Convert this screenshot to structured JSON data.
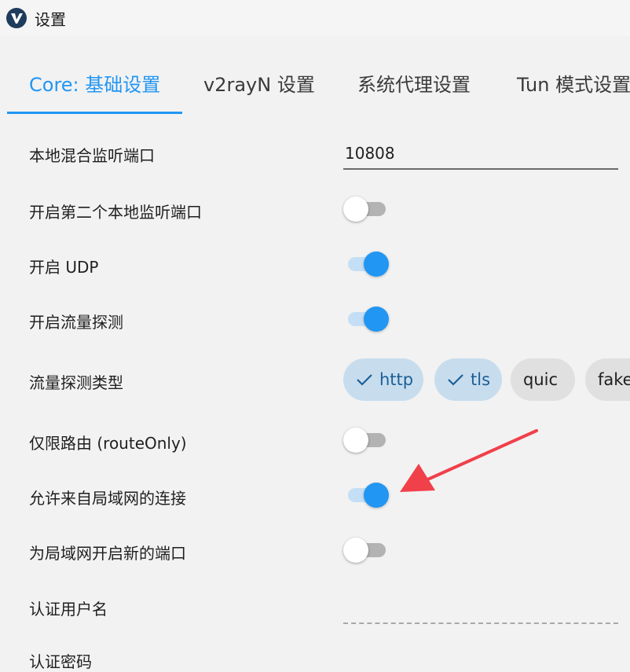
{
  "window": {
    "title": "设置",
    "icon": "v2rayn-app-icon"
  },
  "tabs": [
    {
      "label": "Core: 基础设置",
      "active": true
    },
    {
      "label": "v2rayN 设置",
      "active": false
    },
    {
      "label": "系统代理设置",
      "active": false
    },
    {
      "label": "Tun 模式设置",
      "active": false
    }
  ],
  "settings": {
    "local_port": {
      "label": "本地混合监听端口",
      "value": "10808"
    },
    "second_port": {
      "label": "开启第二个本地监听端口",
      "on": false
    },
    "udp": {
      "label": "开启 UDP",
      "on": true
    },
    "sniffing": {
      "label": "开启流量探测",
      "on": true
    },
    "sniff_types": {
      "label": "流量探测类型",
      "chips": [
        {
          "label": "http",
          "selected": true
        },
        {
          "label": "tls",
          "selected": true
        },
        {
          "label": "quic",
          "selected": false
        },
        {
          "label": "fake",
          "selected": false
        }
      ]
    },
    "route_only": {
      "label": "仅限路由 (routeOnly)",
      "on": false
    },
    "allow_lan": {
      "label": "允许来自局域网的连接",
      "on": true
    },
    "lan_new_port": {
      "label": "为局域网开启新的端口",
      "on": false
    },
    "auth_user": {
      "label": "认证用户名",
      "value": ""
    },
    "auth_pass": {
      "label": "认证密码"
    }
  },
  "colors": {
    "accent": "#2196f3",
    "annotation_arrow": "#f0404a"
  }
}
